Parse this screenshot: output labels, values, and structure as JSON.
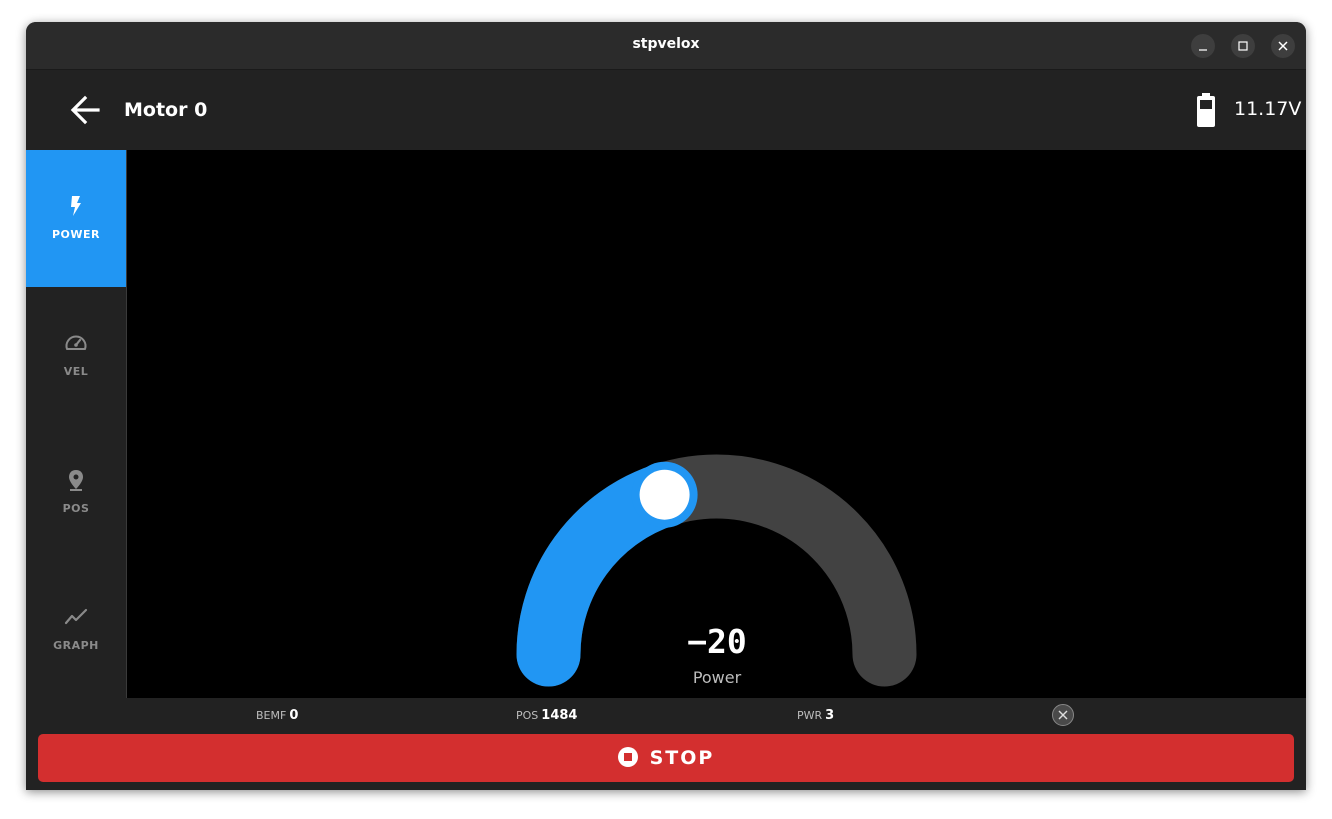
{
  "window": {
    "title": "stpvelox"
  },
  "appbar": {
    "title": "Motor 0",
    "battery_voltage": "11.17V"
  },
  "sidebar": {
    "items": [
      {
        "label": "POWER",
        "icon": "bolt-icon",
        "active": true
      },
      {
        "label": "VEL",
        "icon": "speedometer-icon",
        "active": false
      },
      {
        "label": "POS",
        "icon": "location-pin-icon",
        "active": false
      },
      {
        "label": "GRAPH",
        "icon": "trend-line-icon",
        "active": false
      }
    ]
  },
  "gauge": {
    "value": "−20",
    "label": "Power",
    "min": -100,
    "max": 100,
    "current": -20,
    "fill_color": "#2196f3",
    "track_color": "#424242"
  },
  "status": {
    "bemf_label": "BEMF",
    "bemf_value": "0",
    "pos_label": "POS",
    "pos_value": "1484",
    "pwr_label": "PWR",
    "pwr_value": "3"
  },
  "stop_button": {
    "label": "STOP"
  },
  "colors": {
    "accent": "#2196f3",
    "stop": "#d32f2f",
    "background": "#222222"
  }
}
